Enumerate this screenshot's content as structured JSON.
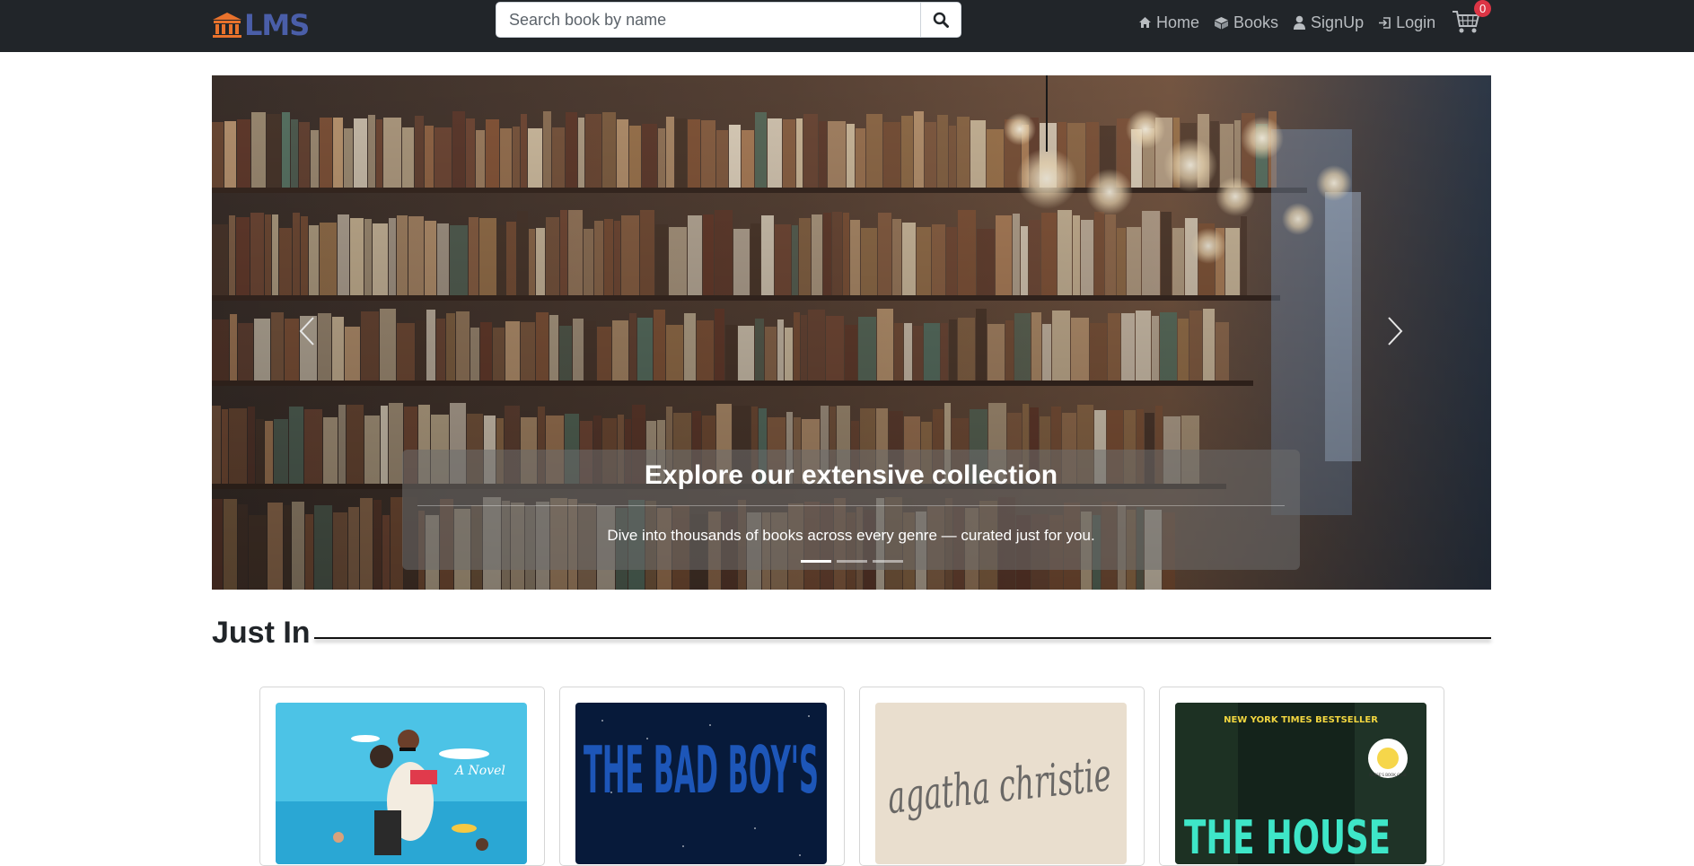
{
  "navbar": {
    "brand": "LMS",
    "search_placeholder": "Search book by name",
    "links": [
      {
        "label": "Home",
        "icon": "home-icon"
      },
      {
        "label": "Books",
        "icon": "box-icon"
      },
      {
        "label": "SignUp",
        "icon": "user-icon"
      },
      {
        "label": "Login",
        "icon": "login-icon"
      }
    ],
    "cart_count": "0"
  },
  "carousel": {
    "caption_title": "Explore our extensive collection",
    "caption_text": "Dive into thousands of books across every genre — curated just for you.",
    "slide_count": 3,
    "active_slide": 1
  },
  "section": {
    "title": "Just In"
  },
  "books": [
    {
      "cover_text": "A Novel",
      "palette": "beach"
    },
    {
      "cover_text": "THE BAD BOY'S",
      "palette": "night"
    },
    {
      "cover_text": "agatha christie",
      "palette": "vintage"
    },
    {
      "cover_top": "NEW YORK TIMES BESTSELLER",
      "cover_text": "THE HOUSE",
      "badge": "REESE'S BOOK CLUB",
      "palette": "forest"
    }
  ],
  "colors": {
    "navbar_bg": "#212529",
    "brand": "#4a5ea8",
    "badge": "#dc3545"
  }
}
